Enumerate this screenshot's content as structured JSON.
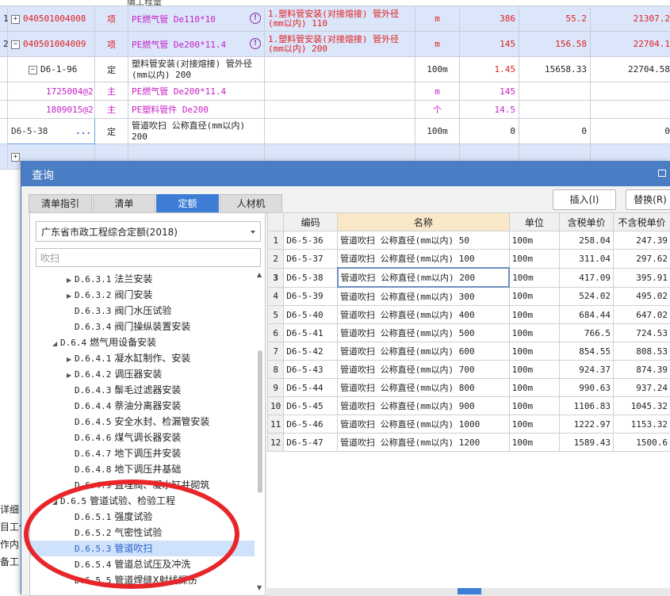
{
  "background_rows": [
    {
      "idx": "1",
      "code": "040501004008",
      "type": "项",
      "name": "PE燃气管 De110*10",
      "feature": "1.塑料管安装(对接熔接) 管外径(mm以内) 110",
      "unit": "m",
      "qty": "386",
      "price": "55.2",
      "total": "21307.2",
      "warn": "!"
    },
    {
      "idx": "2",
      "code": "040501004009",
      "type": "项",
      "name": "PE燃气管 De200*11.4",
      "feature": "1.塑料管安装(对接熔接) 管外径(mm以内) 200",
      "unit": "m",
      "qty": "145",
      "price": "156.58",
      "total": "22704.1",
      "warn": "!"
    },
    {
      "code": "D6-1-96",
      "type": "定",
      "name": "塑料管安装(对接熔接) 管外径(mm以内) 200",
      "unit": "100m",
      "qty": "1.45",
      "price": "15658.33",
      "total": "22704.58"
    },
    {
      "code": "1725004@2",
      "type": "主",
      "name": "PE燃气管 De200*11.4",
      "unit": "m",
      "qty": "145"
    },
    {
      "code": "1809015@2",
      "type": "主",
      "name": "PE塑料管件 De200",
      "unit": "个",
      "qty": "14.5"
    },
    {
      "code": "D6-5-38",
      "type": "定",
      "name": "管道吹扫 公称直径(mm以内) 200",
      "unit": "100m",
      "qty": "0",
      "price": "0",
      "total": "0",
      "edit_btn": "..."
    }
  ],
  "top_partial_label": "编工程量",
  "dialog": {
    "title": "查询",
    "tabs": [
      "清单指引",
      "清单",
      "定额",
      "人材机"
    ],
    "active_tab": "定额",
    "insert_button": "插入(I)",
    "replace_button": "替换(R)",
    "quota_library": "广东省市政工程综合定额(2018)",
    "search_value": "吹扫",
    "tree": [
      {
        "code": "D.6.3.1",
        "label": "法兰安装",
        "level": 3,
        "exp": true
      },
      {
        "code": "D.6.3.2",
        "label": "阀门安装",
        "level": 3,
        "exp": true
      },
      {
        "code": "D.6.3.3",
        "label": "阀门水压试验",
        "level": 3,
        "exp": false
      },
      {
        "code": "D.6.3.4",
        "label": "阀门操纵装置安装",
        "level": 3,
        "exp": false
      },
      {
        "code": "D.6.4",
        "label": "燃气用设备安装",
        "level": 2,
        "open": true
      },
      {
        "code": "D.6.4.1",
        "label": "凝水缸制作、安装",
        "level": 3,
        "exp": true
      },
      {
        "code": "D.6.4.2",
        "label": "调压器安装",
        "level": 3,
        "exp": true
      },
      {
        "code": "D.6.4.3",
        "label": "鬃毛过滤器安装",
        "level": 3,
        "exp": false
      },
      {
        "code": "D.6.4.4",
        "label": "萘油分离器安装",
        "level": 3,
        "exp": false
      },
      {
        "code": "D.6.4.5",
        "label": "安全水封、检漏管安装",
        "level": 3,
        "exp": false
      },
      {
        "code": "D.6.4.6",
        "label": "煤气调长器安装",
        "level": 3,
        "exp": false
      },
      {
        "code": "D.6.4.7",
        "label": "地下调压井安装",
        "level": 3,
        "exp": false
      },
      {
        "code": "D.6.4.8",
        "label": "地下调压井基础",
        "level": 3,
        "exp": false
      },
      {
        "code": "D.6.4.9",
        "label": "直埋阀、凝水缸井砌筑",
        "level": 3,
        "exp": false
      },
      {
        "code": "D.6.5",
        "label": "管道试验、检验工程",
        "level": 2,
        "open": true
      },
      {
        "code": "D.6.5.1",
        "label": "强度试验",
        "level": 3,
        "exp": false
      },
      {
        "code": "D.6.5.2",
        "label": "气密性试验",
        "level": 3,
        "exp": false
      },
      {
        "code": "D.6.5.3",
        "label": "管道吹扫",
        "level": 3,
        "exp": false,
        "selected": true
      },
      {
        "code": "D.6.5.4",
        "label": "管道总试压及冲洗",
        "level": 3,
        "exp": false
      },
      {
        "code": "D.6.5.5",
        "label": "管道焊缝X射线探伤",
        "level": 3,
        "exp": false
      }
    ],
    "table": {
      "headers": [
        "编码",
        "名称",
        "单位",
        "含税单价",
        "不含税单价"
      ],
      "rows": [
        [
          "1",
          "D6-5-36",
          "管道吹扫 公称直径(mm以内) 50",
          "100m",
          "258.04",
          "247.39"
        ],
        [
          "2",
          "D6-5-37",
          "管道吹扫 公称直径(mm以内) 100",
          "100m",
          "311.04",
          "297.62"
        ],
        [
          "3",
          "D6-5-38",
          "管道吹扫 公称直径(mm以内) 200",
          "100m",
          "417.09",
          "395.91"
        ],
        [
          "4",
          "D6-5-39",
          "管道吹扫 公称直径(mm以内) 300",
          "100m",
          "524.02",
          "495.02"
        ],
        [
          "5",
          "D6-5-40",
          "管道吹扫 公称直径(mm以内) 400",
          "100m",
          "684.44",
          "647.02"
        ],
        [
          "6",
          "D6-5-41",
          "管道吹扫 公称直径(mm以内) 500",
          "100m",
          "766.5",
          "724.53"
        ],
        [
          "7",
          "D6-5-42",
          "管道吹扫 公称直径(mm以内) 600",
          "100m",
          "854.55",
          "808.53"
        ],
        [
          "8",
          "D6-5-43",
          "管道吹扫 公称直径(mm以内) 700",
          "100m",
          "924.37",
          "874.39"
        ],
        [
          "9",
          "D6-5-44",
          "管道吹扫 公称直径(mm以内) 800",
          "100m",
          "990.63",
          "937.24"
        ],
        [
          "10",
          "D6-5-45",
          "管道吹扫 公称直径(mm以内) 900",
          "100m",
          "1106.83",
          "1045.32"
        ],
        [
          "11",
          "D6-5-46",
          "管道吹扫 公称直径(mm以内) 1000",
          "100m",
          "1222.97",
          "1153.32"
        ],
        [
          "12",
          "D6-5-47",
          "管道吹扫 公称直径(mm以内) 1200",
          "100m",
          "1589.43",
          "1500.6"
        ]
      ],
      "selected_row": 3
    }
  },
  "bottom_left_labels": [
    "详细",
    "目工作",
    "作内",
    "备工"
  ],
  "colors": {
    "accent": "#3e7dd6",
    "title": "#4a7dc4",
    "row_highlight": "#dbe6fb",
    "code_red": "#e0201e",
    "main_magenta": "#c51fc5",
    "annotation": "#e8262a"
  }
}
